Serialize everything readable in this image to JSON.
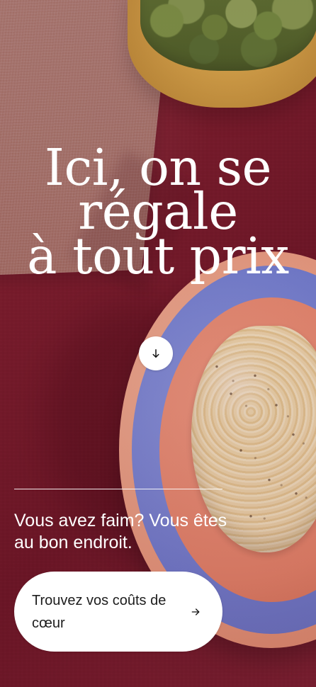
{
  "hero": {
    "title_lines": [
      "Ici, on se",
      "régale",
      "à tout prix"
    ],
    "scroll_icon": "arrow-down-icon",
    "tagline": "Vous avez faim? Vous êtes au bon endroit.",
    "cta_label": "Trouvez vos coûts de cœur",
    "cta_icon": "arrow-right-icon"
  }
}
